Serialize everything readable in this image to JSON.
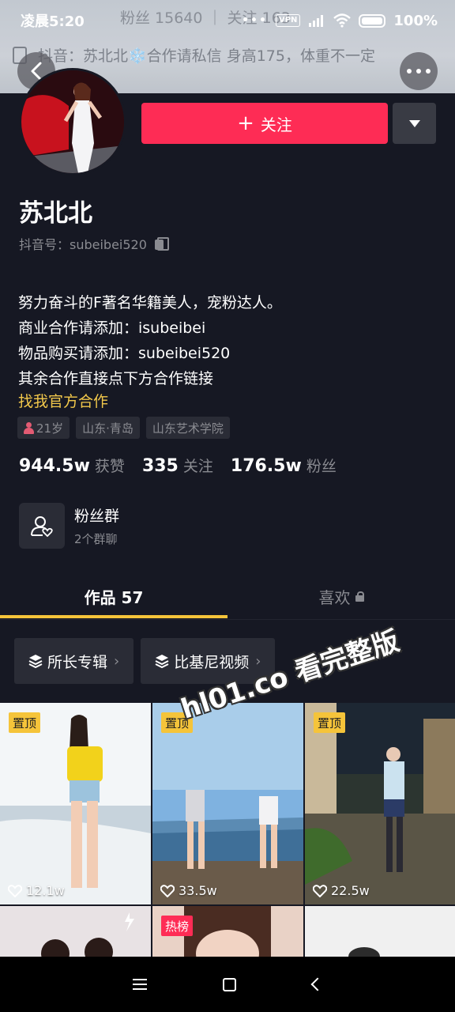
{
  "status_bar": {
    "time": "凌晨5:20",
    "vpn": "VPN",
    "battery": "100%",
    "battery_level": 1.0
  },
  "cover": {
    "stats_text": "粉丝 15640 ｜ 关注 163",
    "notice": "抖音：苏北北❄️合作请私信 身高175，体重不一定"
  },
  "profile": {
    "name": "苏北北",
    "douyin_id": "抖音号：subeibei520",
    "follow_label": "关注",
    "bio_lines": [
      "努力奋斗的F著名华籍美人，宠粉达人。",
      "商业合作请添加：isubeibei",
      "物品购买请添加：subeibei520",
      "其余合作直接点下方合作链接"
    ],
    "official_link": "找我官方合作",
    "tags": {
      "age": "21岁",
      "location": "山东·青岛",
      "school": "山东艺术学院"
    },
    "stats": {
      "likes_value": "944.5w",
      "likes_label": "获赞",
      "following_value": "335",
      "following_label": "关注",
      "fans_value": "176.5w",
      "fans_label": "粉丝"
    },
    "fans_group": {
      "title": "粉丝群",
      "subtitle": "2个群聊"
    }
  },
  "tabs": {
    "works": "作品 57",
    "likes": "喜欢"
  },
  "collections": [
    "所长专辑",
    "比基尼视频"
  ],
  "videos": [
    {
      "badge": "置顶",
      "likes": "12.1w"
    },
    {
      "badge": "置顶",
      "likes": "33.5w"
    },
    {
      "badge": "置顶",
      "likes": "22.5w"
    },
    {
      "badge": "",
      "likes": ""
    },
    {
      "badge": "热榜",
      "likes": ""
    },
    {
      "badge": "",
      "likes": ""
    }
  ],
  "watermark": "hl01.co 看完整版",
  "colors": {
    "background": "#161823",
    "follow": "#fe2c55",
    "accent": "#f5c43a"
  }
}
